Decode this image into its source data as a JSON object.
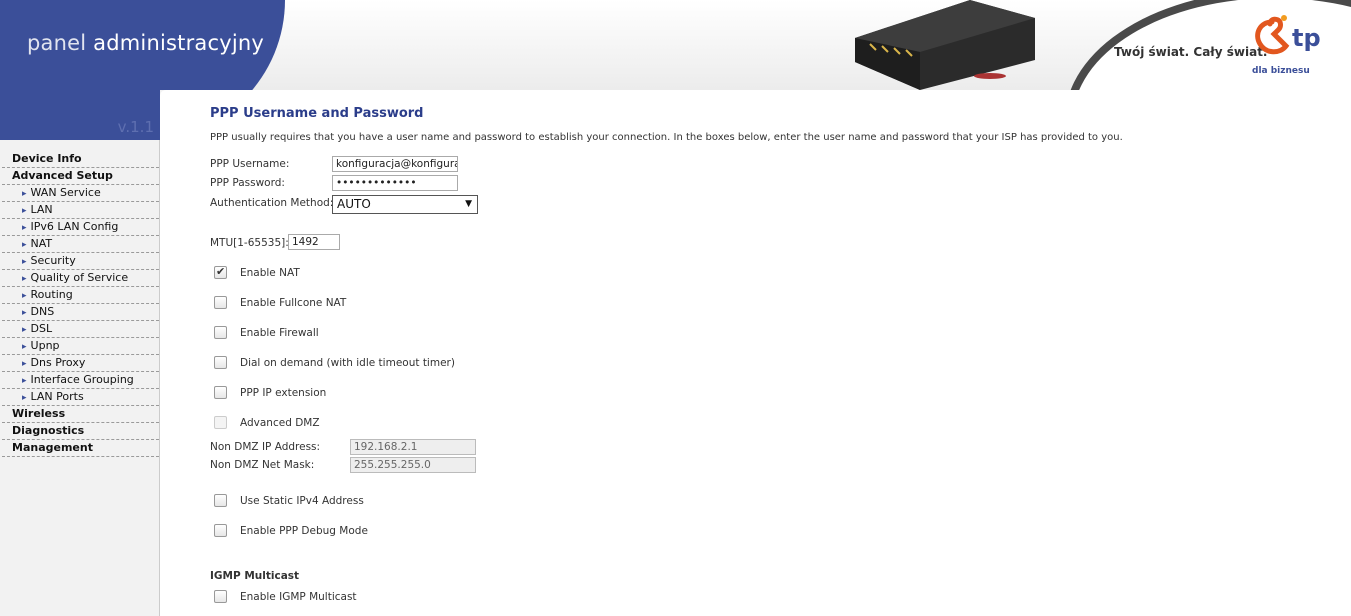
{
  "header": {
    "brand_light": "panel",
    "brand_bold": "administracyjny",
    "version": "v.1.1",
    "slogan": "Twój świat. Cały świat.",
    "logo_text": "tp",
    "logo_sub": "dla biznesu",
    "brand_color": "#3b4f99"
  },
  "sidebar": {
    "items": [
      {
        "label": "Device Info",
        "level": "top"
      },
      {
        "label": "Advanced Setup",
        "level": "top"
      },
      {
        "label": "WAN Service",
        "level": "sub"
      },
      {
        "label": "LAN",
        "level": "sub"
      },
      {
        "label": "IPv6 LAN Config",
        "level": "sub"
      },
      {
        "label": "NAT",
        "level": "sub"
      },
      {
        "label": "Security",
        "level": "sub"
      },
      {
        "label": "Quality of Service",
        "level": "sub"
      },
      {
        "label": "Routing",
        "level": "sub"
      },
      {
        "label": "DNS",
        "level": "sub"
      },
      {
        "label": "DSL",
        "level": "sub"
      },
      {
        "label": "Upnp",
        "level": "sub"
      },
      {
        "label": "Dns Proxy",
        "level": "sub"
      },
      {
        "label": "Interface Grouping",
        "level": "sub"
      },
      {
        "label": "LAN Ports",
        "level": "sub"
      },
      {
        "label": "Wireless",
        "level": "top"
      },
      {
        "label": "Diagnostics",
        "level": "top"
      },
      {
        "label": "Management",
        "level": "top"
      }
    ]
  },
  "main": {
    "title": "PPP Username and Password",
    "intro": "PPP usually requires that you have a user name and password to establish your connection. In the boxes below, enter the user name and password that your ISP has provided to you.",
    "username_label": "PPP Username:",
    "username_value": "konfiguracja@konfiguracja",
    "password_label": "PPP Password:",
    "password_value": "•••••••••••••",
    "auth_label": "Authentication Method:",
    "auth_value": "AUTO",
    "mtu_label": "MTU[1-65535]:",
    "mtu_value": "1492",
    "enable_nat": "Enable NAT",
    "enable_fullcone": "Enable Fullcone NAT",
    "enable_firewall": "Enable Firewall",
    "dial_on_demand": "Dial on demand (with idle timeout timer)",
    "ppp_ip_ext": "PPP IP extension",
    "advanced_dmz": "Advanced DMZ",
    "non_dmz_ip_label": "Non DMZ IP Address:",
    "non_dmz_ip_value": "192.168.2.1",
    "non_dmz_mask_label": "Non DMZ Net Mask:",
    "non_dmz_mask_value": "255.255.255.0",
    "static_ipv4": "Use Static IPv4 Address",
    "ppp_debug": "Enable PPP Debug Mode",
    "igmp_heading": "IGMP Multicast",
    "igmp_enable": "Enable IGMP Multicast"
  }
}
